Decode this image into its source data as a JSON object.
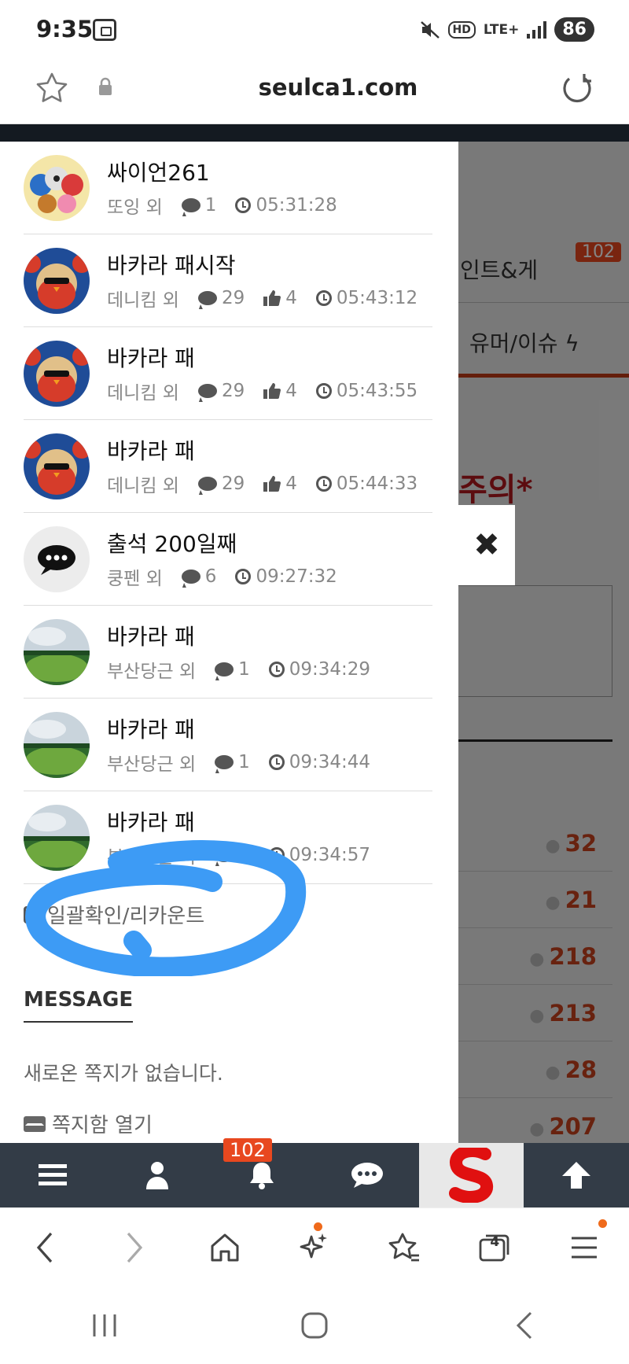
{
  "status_bar": {
    "time": "9:35",
    "battery": "86",
    "network": "LTE+",
    "hd": "HD"
  },
  "browser": {
    "url": "seulca1.com",
    "tab_count": "4"
  },
  "background_page": {
    "tab_partial": "인트&게",
    "notification_badge": "102",
    "category_partial": "유머/이슈",
    "warning_partial": "주의*",
    "row_counts": [
      "32",
      "21",
      "218",
      "213",
      "28",
      "207"
    ]
  },
  "notifications": [
    {
      "title": "싸이언261",
      "author": "또잉 외",
      "comments": "1",
      "likes": "",
      "time": "05:31:28",
      "avatar": "birds"
    },
    {
      "title": "바카라 패시작",
      "author": "데니킴 외",
      "comments": "29",
      "likes": "4",
      "time": "05:43:12",
      "avatar": "chick"
    },
    {
      "title": "바카라 패",
      "author": "데니킴 외",
      "comments": "29",
      "likes": "4",
      "time": "05:43:55",
      "avatar": "chick"
    },
    {
      "title": "바카라 패",
      "author": "데니킴 외",
      "comments": "29",
      "likes": "4",
      "time": "05:44:33",
      "avatar": "chick"
    },
    {
      "title": "출석 200일째",
      "author": "쿵펜 외",
      "comments": "6",
      "likes": "",
      "time": "09:27:32",
      "avatar": "chat"
    },
    {
      "title": "바카라 패",
      "author": "부산당근 외",
      "comments": "1",
      "likes": "",
      "time": "09:34:29",
      "avatar": "field"
    },
    {
      "title": "바카라 패",
      "author": "부산당근 외",
      "comments": "1",
      "likes": "",
      "time": "09:34:44",
      "avatar": "field"
    },
    {
      "title": "바카라 패",
      "author": "부산당근 외",
      "comments": "1",
      "likes": "",
      "time": "09:34:57",
      "avatar": "field"
    }
  ],
  "drawer": {
    "recount_label": "일괄확인/리카운트",
    "message_heading": "MESSAGE",
    "no_message": "새로온 쪽지가 없습니다.",
    "open_inbox": "쪽지함 열기"
  },
  "site_bar": {
    "notification_badge": "102"
  },
  "colors": {
    "accent": "#e8481f",
    "site_bar": "#333c47",
    "scribble": "#3d9bf5"
  }
}
